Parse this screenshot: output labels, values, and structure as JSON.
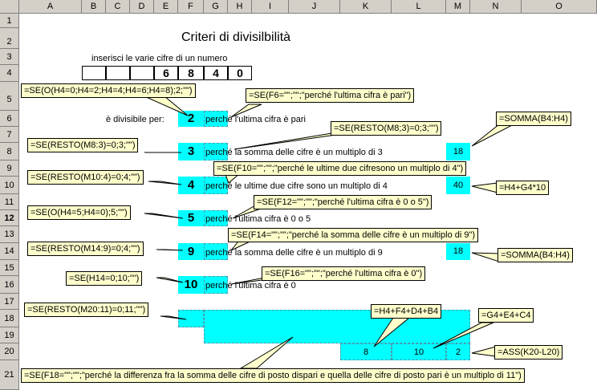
{
  "columns": [
    "A",
    "B",
    "C",
    "D",
    "E",
    "F",
    "G",
    "H",
    "I",
    "J",
    "K",
    "L",
    "M",
    "N",
    "O"
  ],
  "rows": [
    "1",
    "2",
    "3",
    "4",
    "5",
    "6",
    "7",
    "8",
    "9",
    "10",
    "11",
    "12",
    "13",
    "14",
    "15",
    "16",
    "17",
    "18",
    "19",
    "20",
    "21"
  ],
  "selected_row": "12",
  "title": "Criteri di divisilbilità",
  "instruction": "inserisci le varie cifre di un numero",
  "digits": [
    "6",
    "8",
    "4",
    "0"
  ],
  "divisible_label": "è divisibile per:",
  "divisors": [
    "2",
    "3",
    "4",
    "5",
    "9",
    "10"
  ],
  "reasons": [
    "perché l'ultima cifra è pari",
    "perché la somma delle cifre è un multiplo di 3",
    "perché le ultime due cifre sono un multiplo di 4",
    "perché l'ultima cifra è 0 o 5",
    "perché la somma delle cifre è un multiplo di 9",
    "perché l'ultima cifra è 0"
  ],
  "values": {
    "m8": "18",
    "m10": "40",
    "m14": "18",
    "k20": "8",
    "l20": "10",
    "m20": "2"
  },
  "notes": {
    "n1": "=SE(O(H4=0;H4=2;H4=4;H4=6;H4=8);2;\"\")",
    "n2": "=SE(F6=\"\";\"\";\"perché l'ultima cifra è pari\")",
    "n3": "=SE(RESTO(M8;3)=0;3;\"\")",
    "n4": "=SOMMA(B4:H4)",
    "n5": "=SE(RESTO(M8:3)=0;3;\"\")",
    "n6": "=SE(F10=\"\";\"\";\"perché le ultime due cifresono un multiplo di 4\")",
    "n7": "=SE(RESTO(M10:4)=0;4;\"\")",
    "n8": "=H4+G4*10",
    "n9": "=SE(F12=\"\";\"\";\"perché l'ultima cifra è 0 o 5\")",
    "n10": "=SE(O(H4=5;H4=0);5;\"\")",
    "n11": "=SE(F14=\"\";\"\";\"perché la somma delle cifre è un multiplo di 9\")",
    "n12": "=SE(RESTO(M14:9)=0;4;\"\")",
    "n13": "=SOMMA(B4:H4)",
    "n14": "=SE(F16=\"\";\"\";\"perché l'ultima cifra è 0\")",
    "n15": "=SE(H14=0;10;\"\")",
    "n16": "=SE(RESTO(M20:11)=0;11;\"\")",
    "n17": "=H4+F4+D4+B4",
    "n18": "=G4+E4+C4",
    "n19": "=ASS(K20-L20)",
    "n20": "=SE(F18=\"\";\"\";\"perché la differenza fra la somma delle cifre di posto dispari e quella delle cifre di posto pari è  un multiplo di 11\")"
  },
  "colors": {
    "highlight": "#00ffff",
    "note_bg": "#ffffcc",
    "header_bg": "#d4d0c8"
  }
}
